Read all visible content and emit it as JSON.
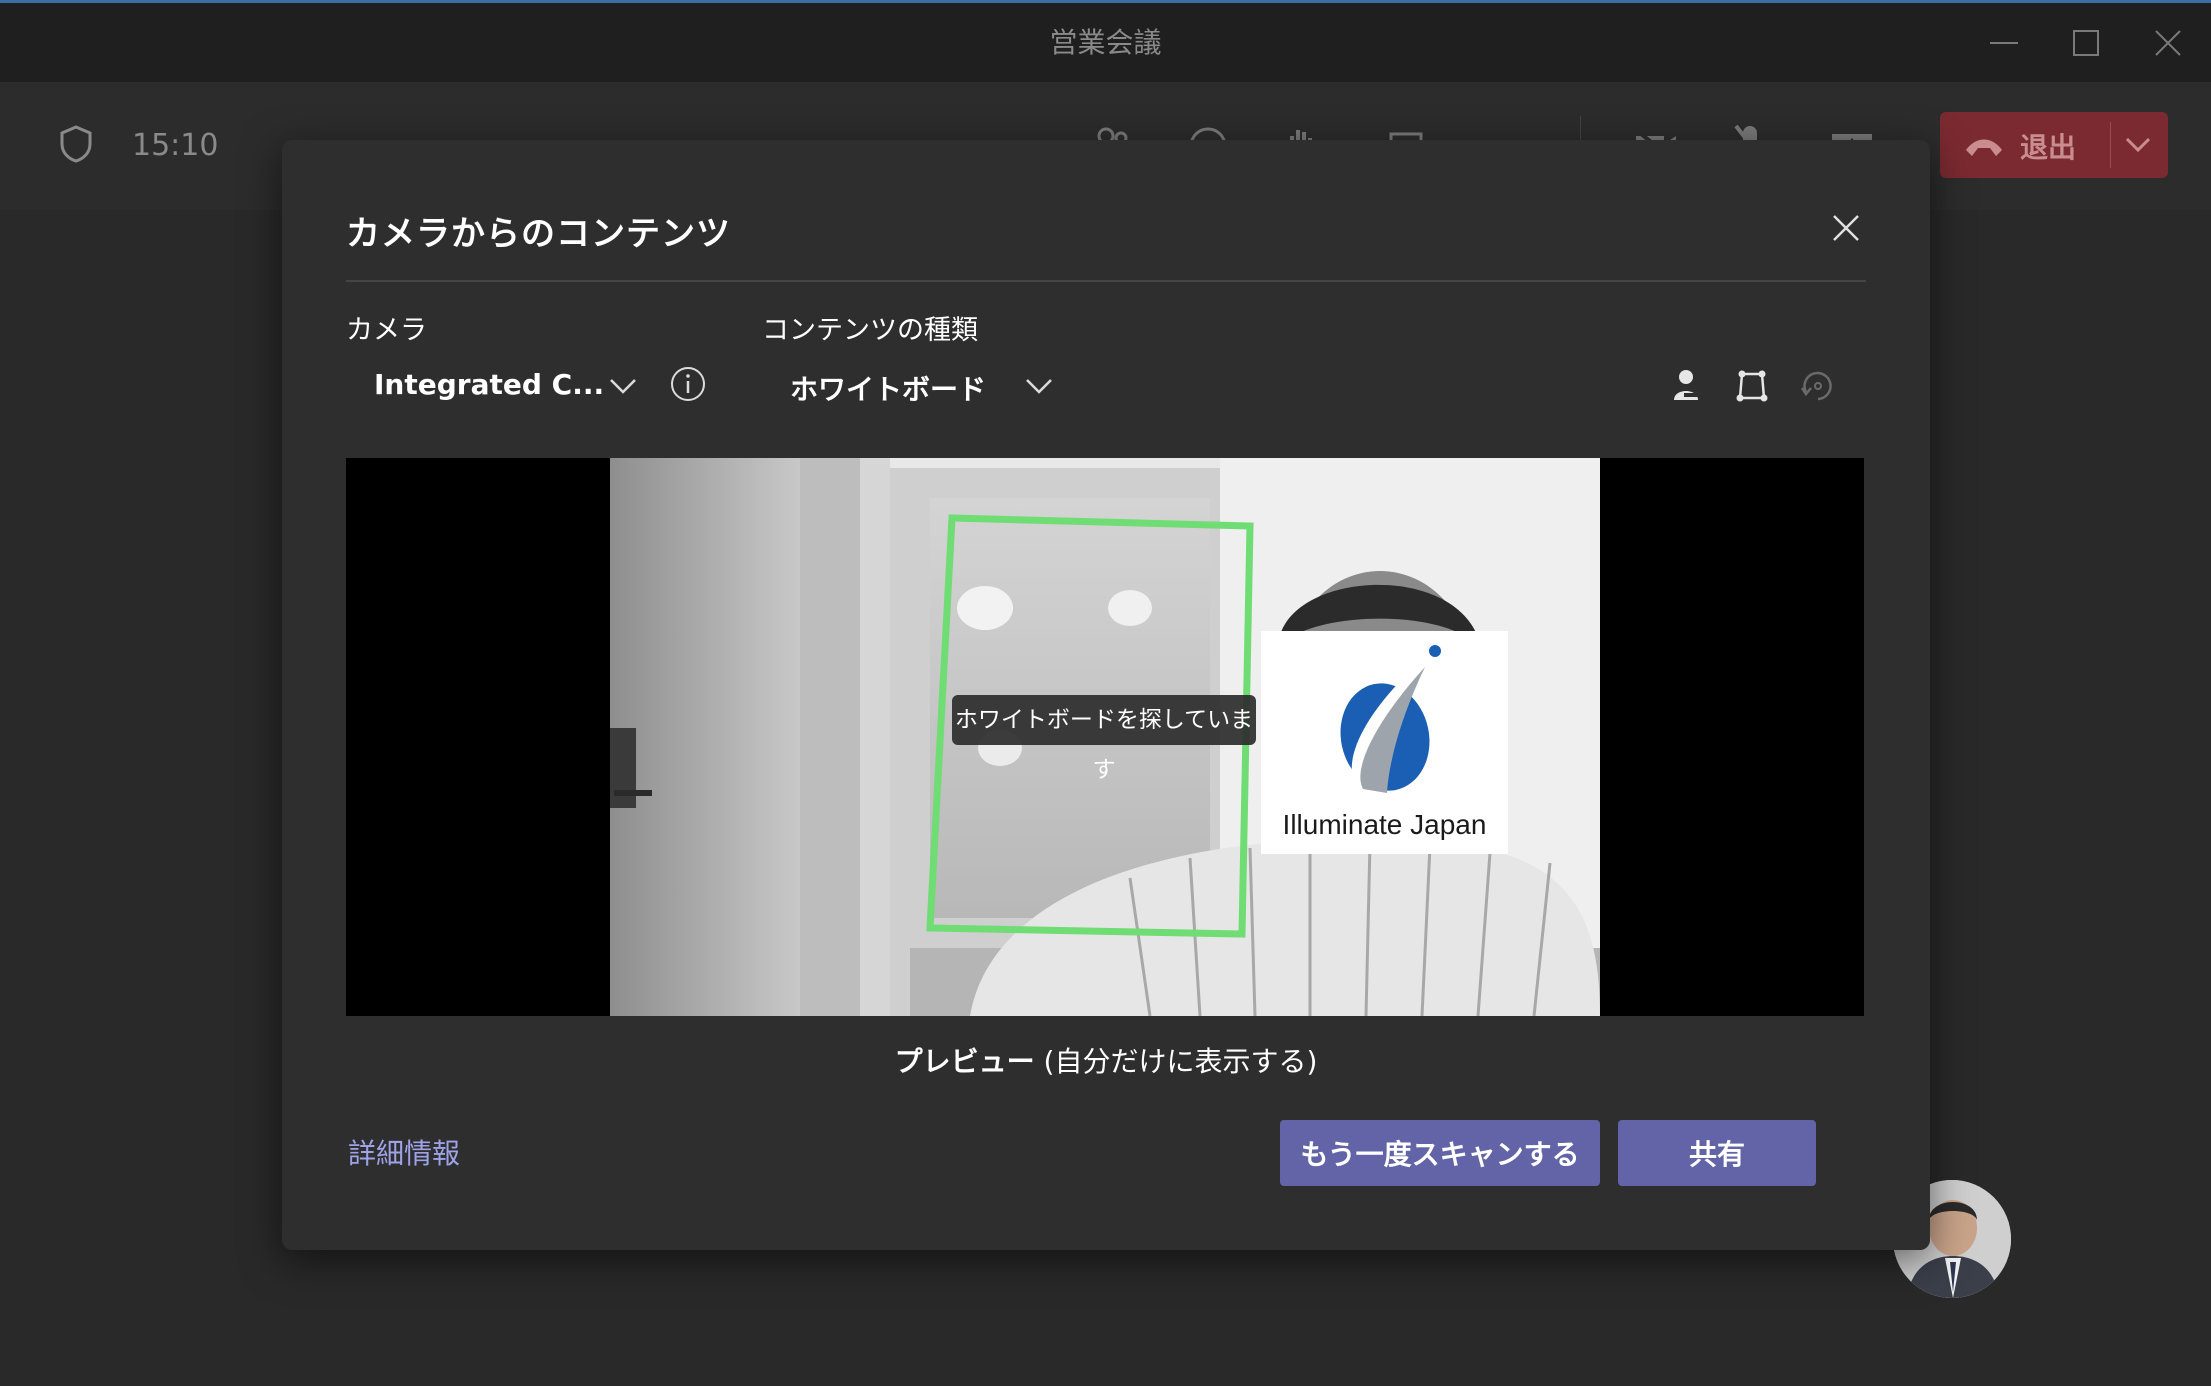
{
  "window": {
    "title": "営業会議"
  },
  "toolbar": {
    "timer": "15:10",
    "leave_label": "退出"
  },
  "dialog": {
    "title": "カメラからのコンテンツ",
    "camera_label": "カメラ",
    "camera_value": "Integrated C...",
    "content_type_label": "コンテンツの種類",
    "content_type_value": "ホワイトボード",
    "status_text": "ホワイトボードを探しています",
    "logo_text": "Illuminate Japan",
    "preview_caption_bold": "プレビュー",
    "preview_caption_rest": " (自分だけに表示する)",
    "details_link": "詳細情報",
    "rescan_button": "もう一度スキャンする",
    "share_button": "共有"
  },
  "colors": {
    "accent": "#6264a7",
    "leave": "#7a2a30",
    "detect_frame": "#6fdc74",
    "link": "#9ea3e8"
  },
  "icons": [
    "shield-icon",
    "participants-icon",
    "chat-icon",
    "raise-hand-icon",
    "share-tray-icon",
    "camera-off-icon",
    "mic-off-icon",
    "share-screen-icon",
    "phone-icon",
    "chevron-down-icon",
    "close-icon",
    "info-icon",
    "hide-person-icon",
    "crop-corners-icon",
    "rotate-icon",
    "minimize-icon",
    "maximize-icon"
  ]
}
